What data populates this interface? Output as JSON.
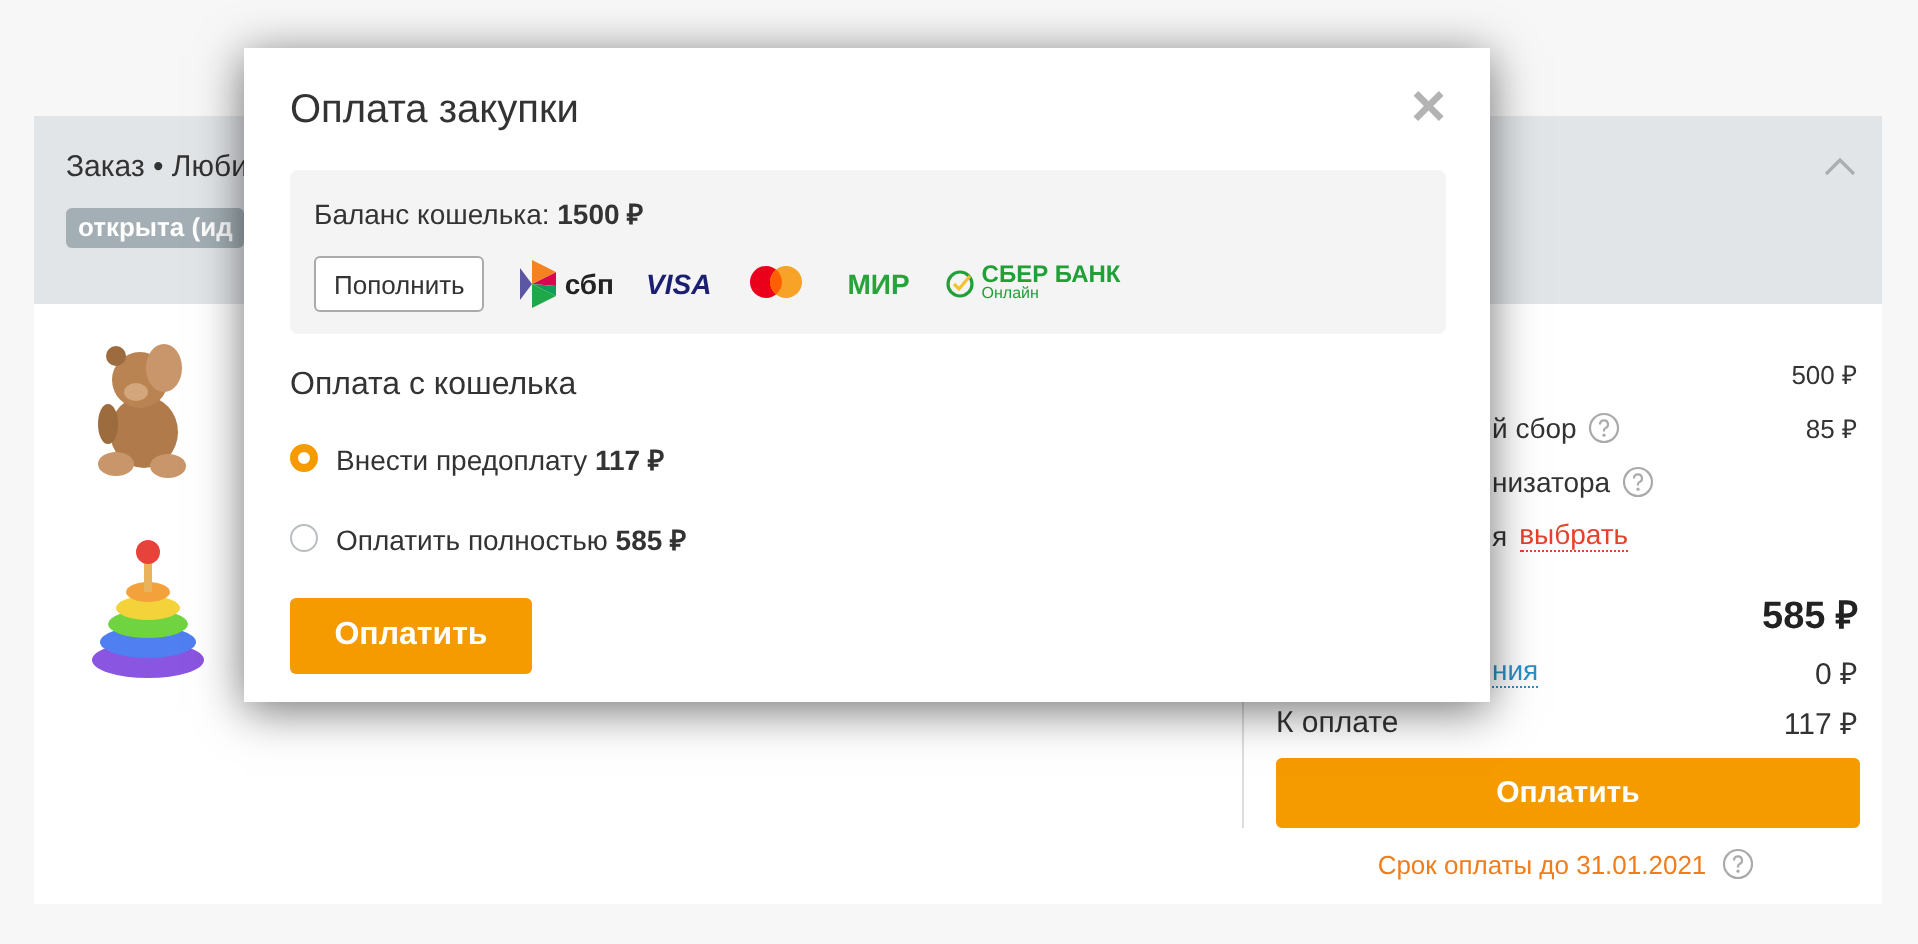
{
  "order_header": {
    "title": "Заказ • Люби",
    "status": "открыта (ид",
    "expanded": true
  },
  "summary": {
    "rows": [
      {
        "kind": "line",
        "value": "500 ₽"
      },
      {
        "kind": "line",
        "cut": true,
        "label": "й сбор",
        "help": true,
        "value": "85 ₽"
      },
      {
        "kind": "line",
        "cut": true,
        "label": "низатора",
        "help": true
      },
      {
        "kind": "line",
        "cut": true,
        "label": "я",
        "link": {
          "text": "выбрать",
          "color": "#e8402b"
        }
      },
      {
        "kind": "total",
        "value": "585 ₽"
      },
      {
        "kind": "line",
        "cut": true,
        "link": {
          "text": "ния",
          "color": "#2b8fc6"
        },
        "value": "0 ₽"
      },
      {
        "kind": "line",
        "cut": false,
        "label": "К оплате",
        "value": "117 ₽"
      }
    ],
    "pay_button": "Оплатить",
    "deadline": "Срок оплаты до 31.01.2021",
    "deadline_help": true
  },
  "modal": {
    "title": "Оплата закупки",
    "close": "×",
    "balance": "Баланс кошелька: **1500 ₽**",
    "top_up_button": "Пополнить",
    "payment_methods": [
      {
        "kind": "sbp",
        "label": "сбп"
      },
      {
        "kind": "visa",
        "label": "VISA"
      },
      {
        "kind": "mastercard"
      },
      {
        "kind": "mir",
        "label": "МИР"
      },
      {
        "kind": "sber",
        "label": "СБЕР БАНК",
        "sublabel": "Онлайн"
      }
    ],
    "section_title": "Оплата с кошелька",
    "options": [
      {
        "label": "Внести предоплату **117 ₽**",
        "selected": true
      },
      {
        "label": "Оплатить полностью **585 ₽**",
        "selected": false
      }
    ],
    "pay_button": "Оплатить"
  }
}
